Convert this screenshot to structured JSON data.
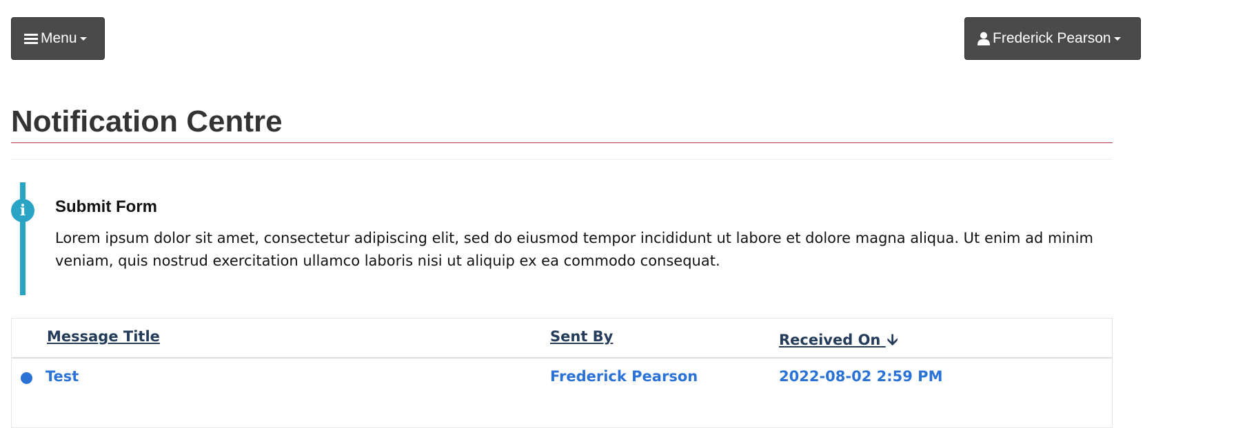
{
  "header": {
    "menu_label": "Menu",
    "user_label": "Frederick Pearson"
  },
  "page": {
    "title": "Notification Centre"
  },
  "alert": {
    "title": "Submit Form",
    "text": "Lorem ipsum dolor sit amet, consectetur adipiscing elit, sed do eiusmod tempor incididunt ut labore et dolore magna aliqua. Ut enim ad minim veniam, quis nostrud exercitation ullamco laboris nisi ut aliquip ex ea commodo consequat.",
    "icon": "info-circle-icon",
    "accent_color": "#2aa4c4"
  },
  "table": {
    "columns": {
      "title": "Message Title",
      "sent_by": "Sent By",
      "received_on": "Received On"
    },
    "sort": {
      "column": "received_on",
      "direction": "descending"
    },
    "rows": [
      {
        "title": "Test",
        "sent_by": "Frederick Pearson",
        "received_on": "2022-08-02 2:59 PM",
        "unread": true
      }
    ]
  },
  "colors": {
    "button_bg": "#4a4a4a",
    "title_rule": "#b5334c",
    "link": "#2b72d6",
    "header_link": "#243c5a"
  }
}
